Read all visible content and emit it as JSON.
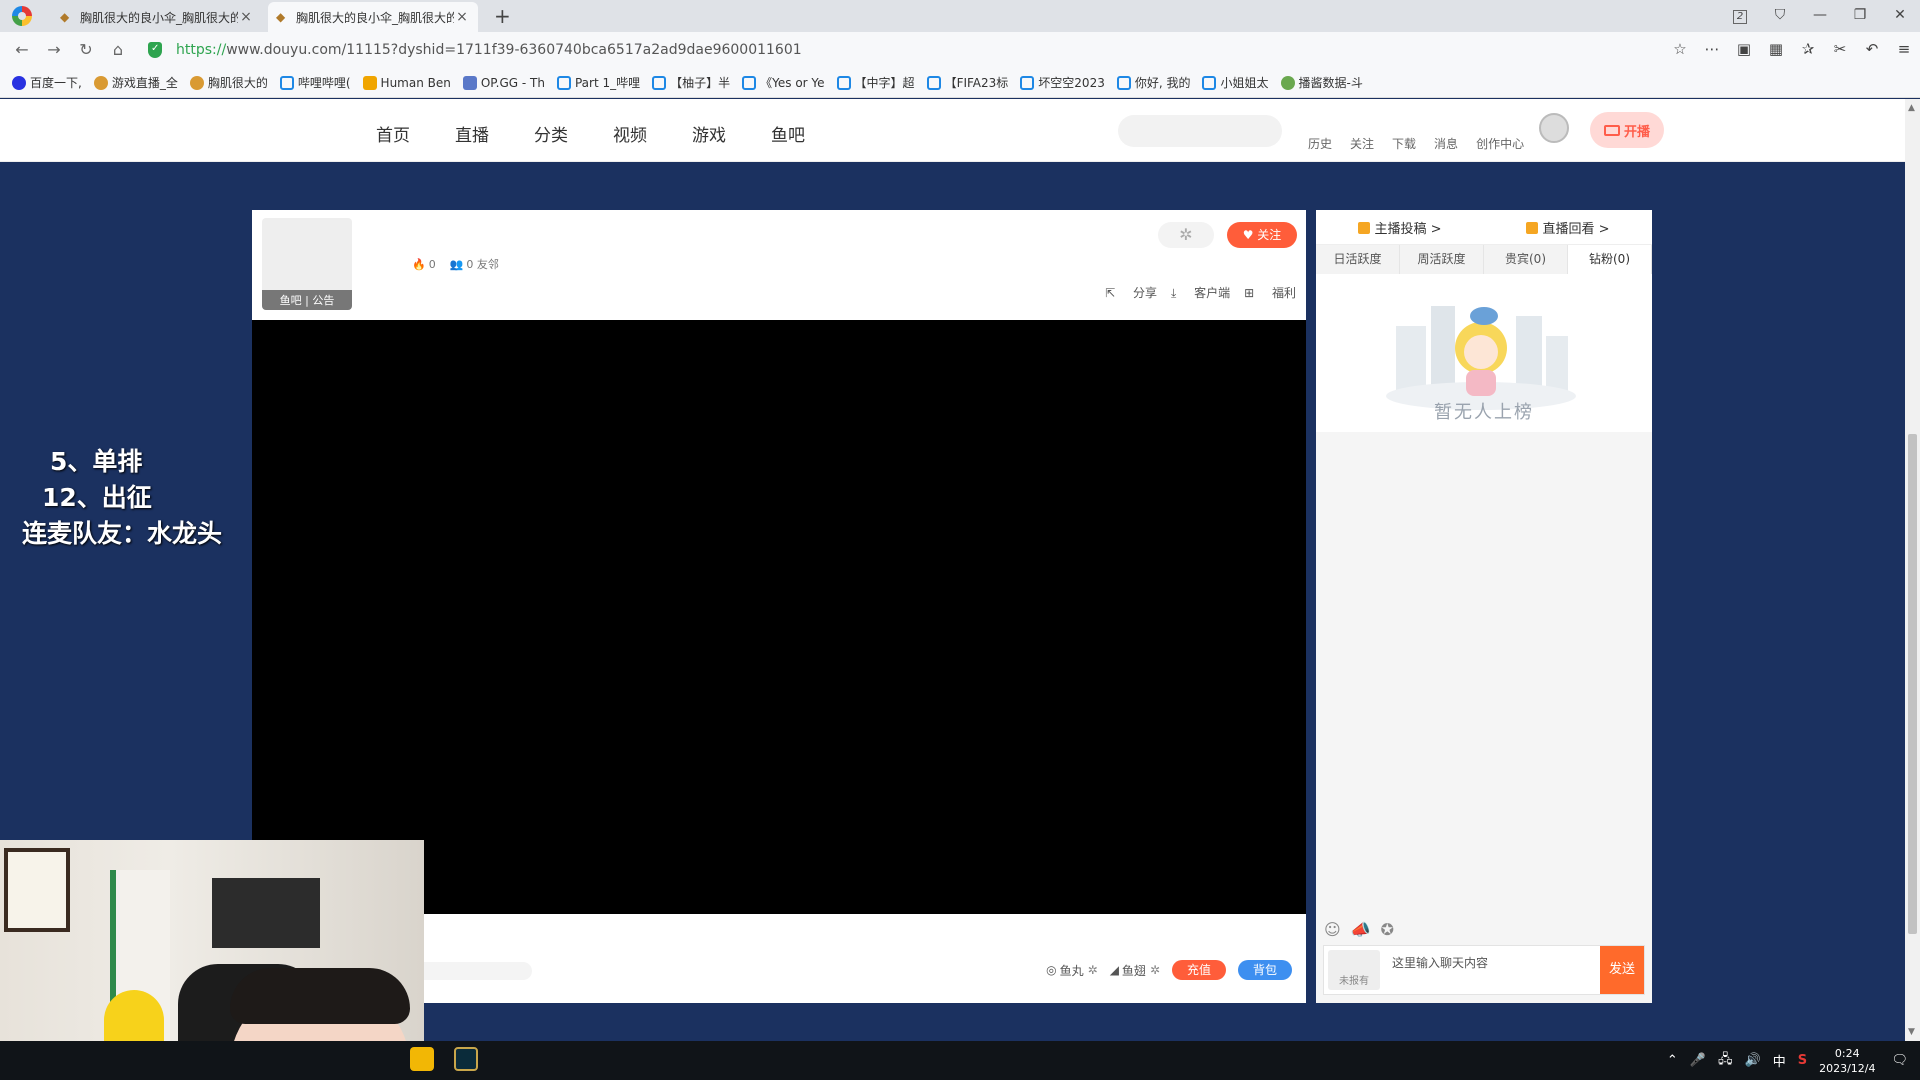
{
  "browser": {
    "tabs": [
      {
        "title": "胸肌很大的良小伞_胸肌很大的",
        "active": false
      },
      {
        "title": "胸肌很大的良小伞_胸肌很大的",
        "active": true
      }
    ],
    "url_scheme": "https://",
    "url_rest": "www.douyu.com/11115?dyshid=1711f39-6360740bca6517a2ad9dae9600011601",
    "tab_count_badge": "2"
  },
  "bookmarks": [
    {
      "label": "百度一下,",
      "icon": "baidu"
    },
    {
      "label": "游戏直播_全",
      "icon": "game"
    },
    {
      "label": "胸肌很大的",
      "icon": "game"
    },
    {
      "label": "哔哩哔哩(",
      "icon": "tv"
    },
    {
      "label": "Human Ben",
      "icon": "bolt"
    },
    {
      "label": "OP.GG - Th",
      "icon": "op"
    },
    {
      "label": "Part 1_哔哩",
      "icon": "tv"
    },
    {
      "label": "【柚子】半",
      "icon": "tv"
    },
    {
      "label": "《Yes or Ye",
      "icon": "tv"
    },
    {
      "label": "【中字】超",
      "icon": "tv"
    },
    {
      "label": "【FIFA23标",
      "icon": "tv"
    },
    {
      "label": "坏空空2023",
      "icon": "tv"
    },
    {
      "label": "你好, 我的",
      "icon": "tv"
    },
    {
      "label": "小姐姐太",
      "icon": "tv"
    },
    {
      "label": "播酱数据-斗",
      "icon": "chart"
    }
  ],
  "site": {
    "nav": [
      "首页",
      "直播",
      "分类",
      "视频",
      "游戏",
      "鱼吧"
    ],
    "header_links": [
      "历史",
      "关注",
      "下载",
      "消息",
      "创作中心"
    ],
    "live_button": "开播"
  },
  "overlay": [
    "5、单排",
    "12、出征",
    "连麦队友：水龙头"
  ],
  "player": {
    "anchor_tags": "鱼吧 | 公告",
    "heat": "0",
    "fans": "0 友邻",
    "follow": "关注",
    "actions": [
      "分享",
      "客户端",
      "福利"
    ],
    "bottom": {
      "fishball": "鱼丸",
      "fishwing": "鱼翅",
      "recharge": "充值",
      "backpack": "背包"
    }
  },
  "sidebar": {
    "top_links": [
      "主播投稿 >",
      "直播回看 >"
    ],
    "rank_tabs": [
      "日活跃度",
      "周活跃度",
      "贵宾(0)",
      "钻粉(0)"
    ],
    "active_rank_tab": 3,
    "empty_text": "暂无人上榜",
    "chat_level": "未报有",
    "chat_placeholder": "这里输入聊天内容",
    "send": "发送"
  },
  "taskbar": {
    "time": "0:24",
    "date": "2023/12/4",
    "ime": "中"
  },
  "colors": {
    "page_bg": "#1b3160",
    "accent_orange": "#ff5d3a",
    "accent_blue": "#3d8ff0"
  }
}
